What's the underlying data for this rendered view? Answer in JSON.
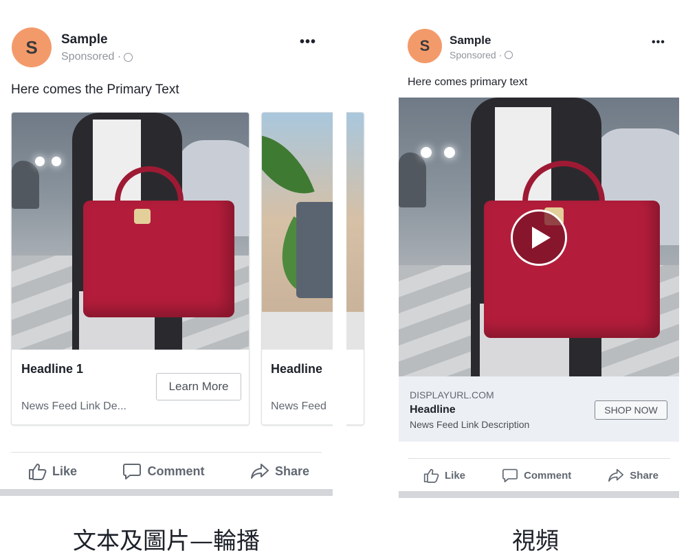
{
  "carousel_ad": {
    "page": {
      "avatar_letter": "S",
      "name": "Sample",
      "sponsored": "Sponsored ·"
    },
    "primary_text": "Here comes the Primary Text",
    "cards": [
      {
        "headline": "Headline 1",
        "description": "News Feed Link De...",
        "cta": "Learn More"
      },
      {
        "headline": "Headline",
        "description": "News Feed"
      }
    ],
    "actions": {
      "like": "Like",
      "comment": "Comment",
      "share": "Share"
    },
    "caption": "文本及圖片—輪播"
  },
  "video_ad": {
    "page": {
      "avatar_letter": "S",
      "name": "Sample",
      "sponsored": "Sponsored ·"
    },
    "primary_text": "Here comes primary text",
    "display_url": "DISPLAYURL.COM",
    "headline": "Headline",
    "description": "News Feed Link Description",
    "cta": "SHOP NOW",
    "actions": {
      "like": "Like",
      "comment": "Comment",
      "share": "Share"
    },
    "caption": "視頻"
  },
  "colors": {
    "avatar": "#f39a6b",
    "bag": "#b31d3b",
    "text_secondary": "#606770"
  },
  "icons": [
    "globe-icon",
    "more-icon",
    "like-icon",
    "comment-icon",
    "share-icon",
    "play-icon"
  ]
}
